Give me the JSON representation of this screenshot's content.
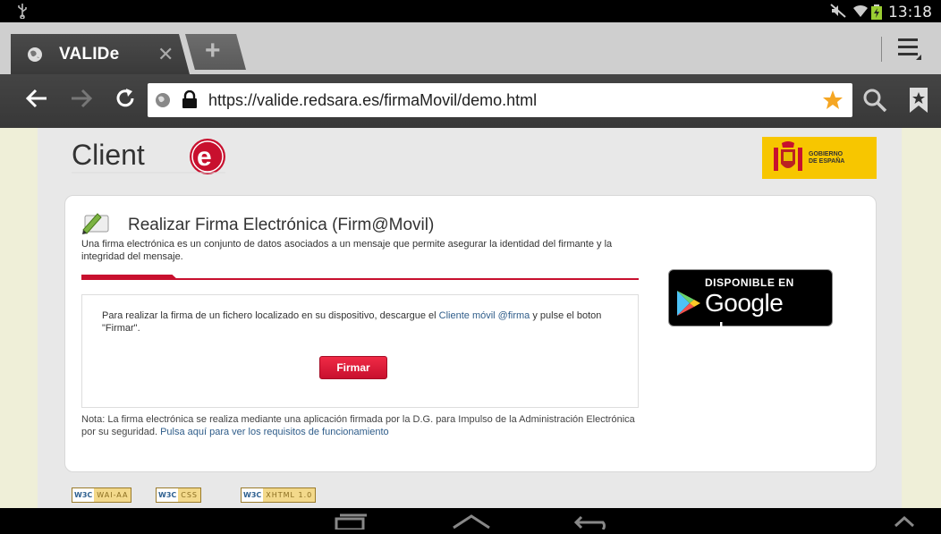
{
  "status_bar": {
    "time": "13:18"
  },
  "tabs": [
    {
      "title": "VALIDe"
    }
  ],
  "toolbar": {
    "url": "https://valide.redsara.es/firmaMovil/demo.html"
  },
  "page": {
    "logo_text": "Client",
    "gov_label": "GOBIERNO\nDE ESPAÑA",
    "heading": "Realizar Firma Electrónica (Firm@Movil)",
    "intro": "Una firma electrónica es un conjunto de datos asociados a un mensaje que permite asegurar la identidad del firmante y la integridad del mensaje.",
    "instructions_before": "Para realizar la firma de un fichero localizado en su dispositivo, descargue el ",
    "instructions_link": "Cliente móvil @firma",
    "instructions_after": " y pulse el boton \"Firmar\".",
    "firmar_button": "Firmar",
    "note_text": "Nota: La firma electrónica se realiza mediante una aplicación firmada por la D.G. para Impulso de la Administración Electrónica por su seguridad. ",
    "note_link": "Pulsa aquí para ver los requisitos de funcionamiento",
    "google_play_top": "DISPONIBLE EN",
    "google_play_brand": "Google play",
    "badges": [
      {
        "w3c": "W3C",
        "text": "WAI-AA"
      },
      {
        "w3c": "W3C",
        "text": "CSS"
      },
      {
        "w3c": "W3C",
        "text": "XHTML 1.0"
      }
    ]
  },
  "colors": {
    "accent_red": "#c8102e",
    "link_blue": "#2f5d8a",
    "star_orange": "#f5a623",
    "gov_yellow": "#f7c600"
  }
}
